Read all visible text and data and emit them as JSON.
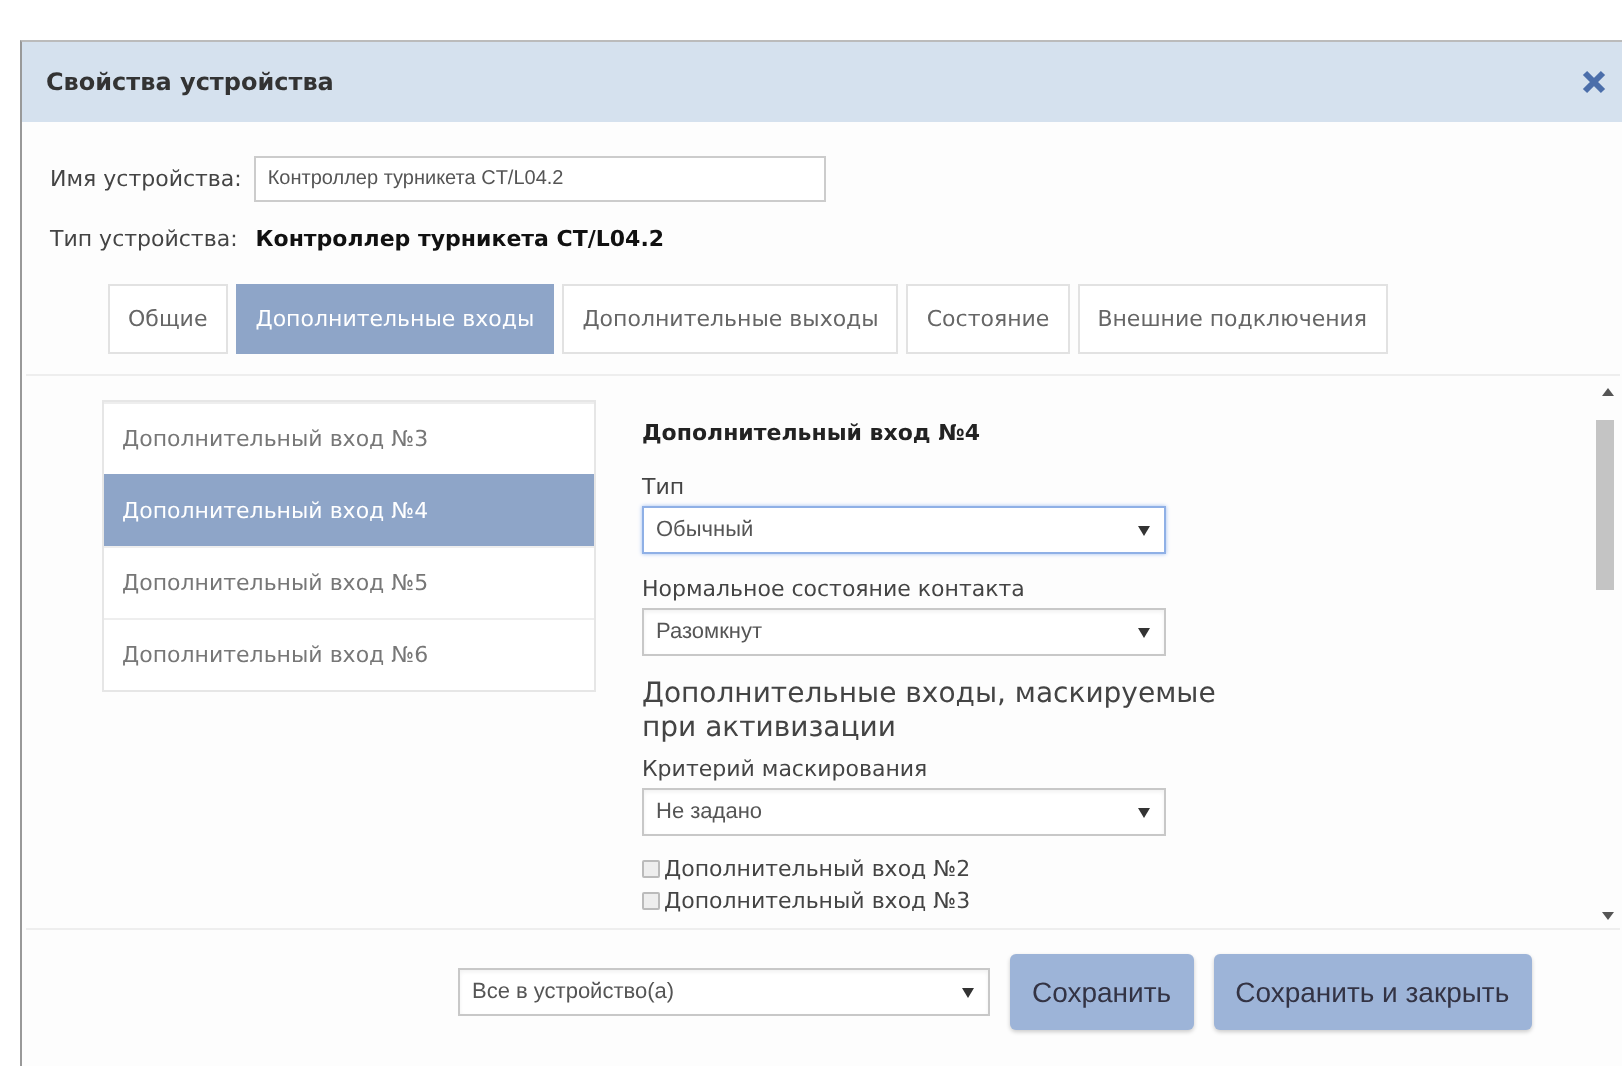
{
  "window": {
    "title": "Свойства устройства"
  },
  "device_name": {
    "label": "Имя устройства:",
    "value": "Контроллер турникета CT/L04.2"
  },
  "device_type": {
    "label": "Тип устройства:",
    "value": "Контроллер турникета CT/L04.2"
  },
  "tabs": [
    {
      "label": "Общие",
      "selected": false
    },
    {
      "label": "Дополнительные входы",
      "selected": true
    },
    {
      "label": "Дополнительные выходы",
      "selected": false
    },
    {
      "label": "Состояние",
      "selected": false
    },
    {
      "label": "Внешние подключения",
      "selected": false
    }
  ],
  "inputs_list": [
    {
      "label": "Дополнительный вход №3",
      "selected": false
    },
    {
      "label": "Дополнительный вход №4",
      "selected": true
    },
    {
      "label": "Дополнительный вход №5",
      "selected": false
    },
    {
      "label": "Дополнительный вход №6",
      "selected": false
    }
  ],
  "form": {
    "title": "Дополнительный вход №4",
    "fields": [
      {
        "label": "Тип",
        "value": "Обычный",
        "focused": true
      },
      {
        "label": "Нормальное состояние контакта",
        "value": "Разомкнут",
        "focused": false
      }
    ],
    "section_title": "Дополнительные входы, маскируемые при активизации",
    "masking": {
      "label": "Критерий маскирования",
      "value": "Не задано",
      "focused": false
    },
    "checkboxes": [
      {
        "label": "Дополнительный вход №2",
        "checked": false
      },
      {
        "label": "Дополнительный вход №3",
        "checked": false
      }
    ]
  },
  "footer": {
    "target": {
      "value": "Все в устройство(а)"
    },
    "buttons": [
      "Сохранить",
      "Сохранить и закрыть"
    ]
  }
}
